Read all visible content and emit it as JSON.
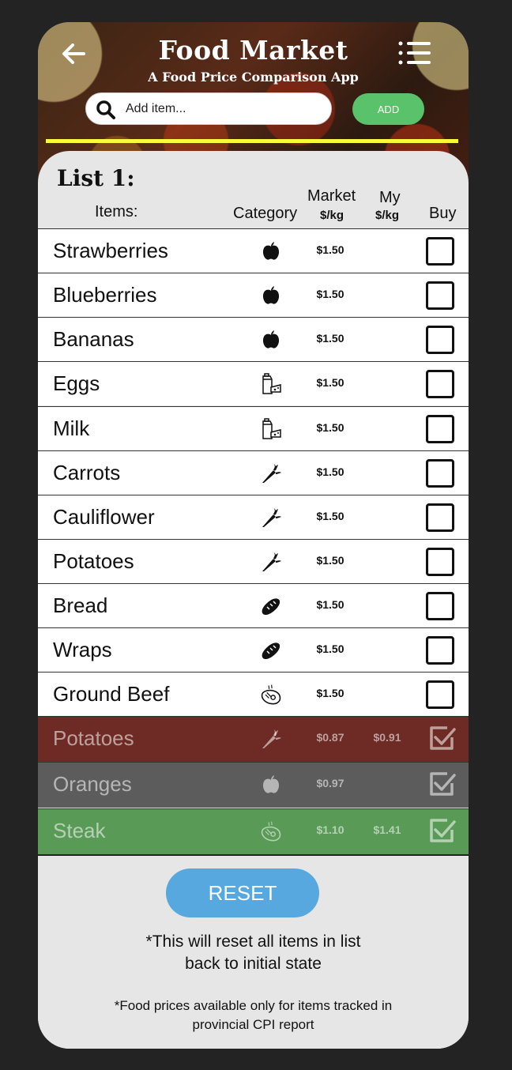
{
  "header": {
    "title": "Food Market",
    "subtitle": "A Food Price Comparison App",
    "back_icon": "arrow-left-icon",
    "menu_icon": "list-menu-icon"
  },
  "search": {
    "placeholder": "Add item...",
    "value": "",
    "add_label": "ADD"
  },
  "list": {
    "title": "List 1:",
    "columns": {
      "items": "Items:",
      "category": "Category",
      "market": "Market",
      "market_unit": "$/kg",
      "my": "My",
      "my_unit": "$/kg",
      "buy": "Buy"
    },
    "rows": [
      {
        "name": "Strawberries",
        "category": "apple-icon",
        "market": "$1.50",
        "my": "",
        "checked": false
      },
      {
        "name": "Blueberries",
        "category": "apple-icon",
        "market": "$1.50",
        "my": "",
        "checked": false
      },
      {
        "name": "Bananas",
        "category": "apple-icon",
        "market": "$1.50",
        "my": "",
        "checked": false
      },
      {
        "name": "Eggs",
        "category": "milk-carton-cheese-icon",
        "market": "$1.50",
        "my": "",
        "checked": false
      },
      {
        "name": "Milk",
        "category": "milk-carton-cheese-icon",
        "market": "$1.50",
        "my": "",
        "checked": false
      },
      {
        "name": "Carrots",
        "category": "carrot-icon",
        "market": "$1.50",
        "my": "",
        "checked": false
      },
      {
        "name": "Cauliflower",
        "category": "carrot-icon",
        "market": "$1.50",
        "my": "",
        "checked": false
      },
      {
        "name": "Potatoes",
        "category": "carrot-icon",
        "market": "$1.50",
        "my": "",
        "checked": false
      },
      {
        "name": "Bread",
        "category": "bread-icon",
        "market": "$1.50",
        "my": "",
        "checked": false
      },
      {
        "name": "Wraps",
        "category": "bread-icon",
        "market": "$1.50",
        "my": "",
        "checked": false
      },
      {
        "name": "Ground Beef",
        "category": "steak-icon",
        "market": "$1.50",
        "my": "",
        "checked": false
      }
    ],
    "done_rows": [
      {
        "name": "Potatoes",
        "category": "carrot-icon",
        "market": "$0.87",
        "my": "$0.91",
        "checked": true,
        "color": "#6e2a25"
      },
      {
        "name": "Oranges",
        "category": "apple-icon",
        "market": "$0.97",
        "my": "",
        "checked": true,
        "color": "#5c5c5c"
      },
      {
        "name": "Steak",
        "category": "steak-icon",
        "market": "$1.10",
        "my": "$1.41",
        "checked": true,
        "color": "#5a9a57"
      }
    ]
  },
  "footer": {
    "reset_label": "RESET",
    "reset_note_1": "*This will reset all items in list",
    "reset_note_2": "back to initial state",
    "cpi_note_1": "*Food prices available only for items tracked in",
    "cpi_note_2": "provincial CPI report"
  }
}
